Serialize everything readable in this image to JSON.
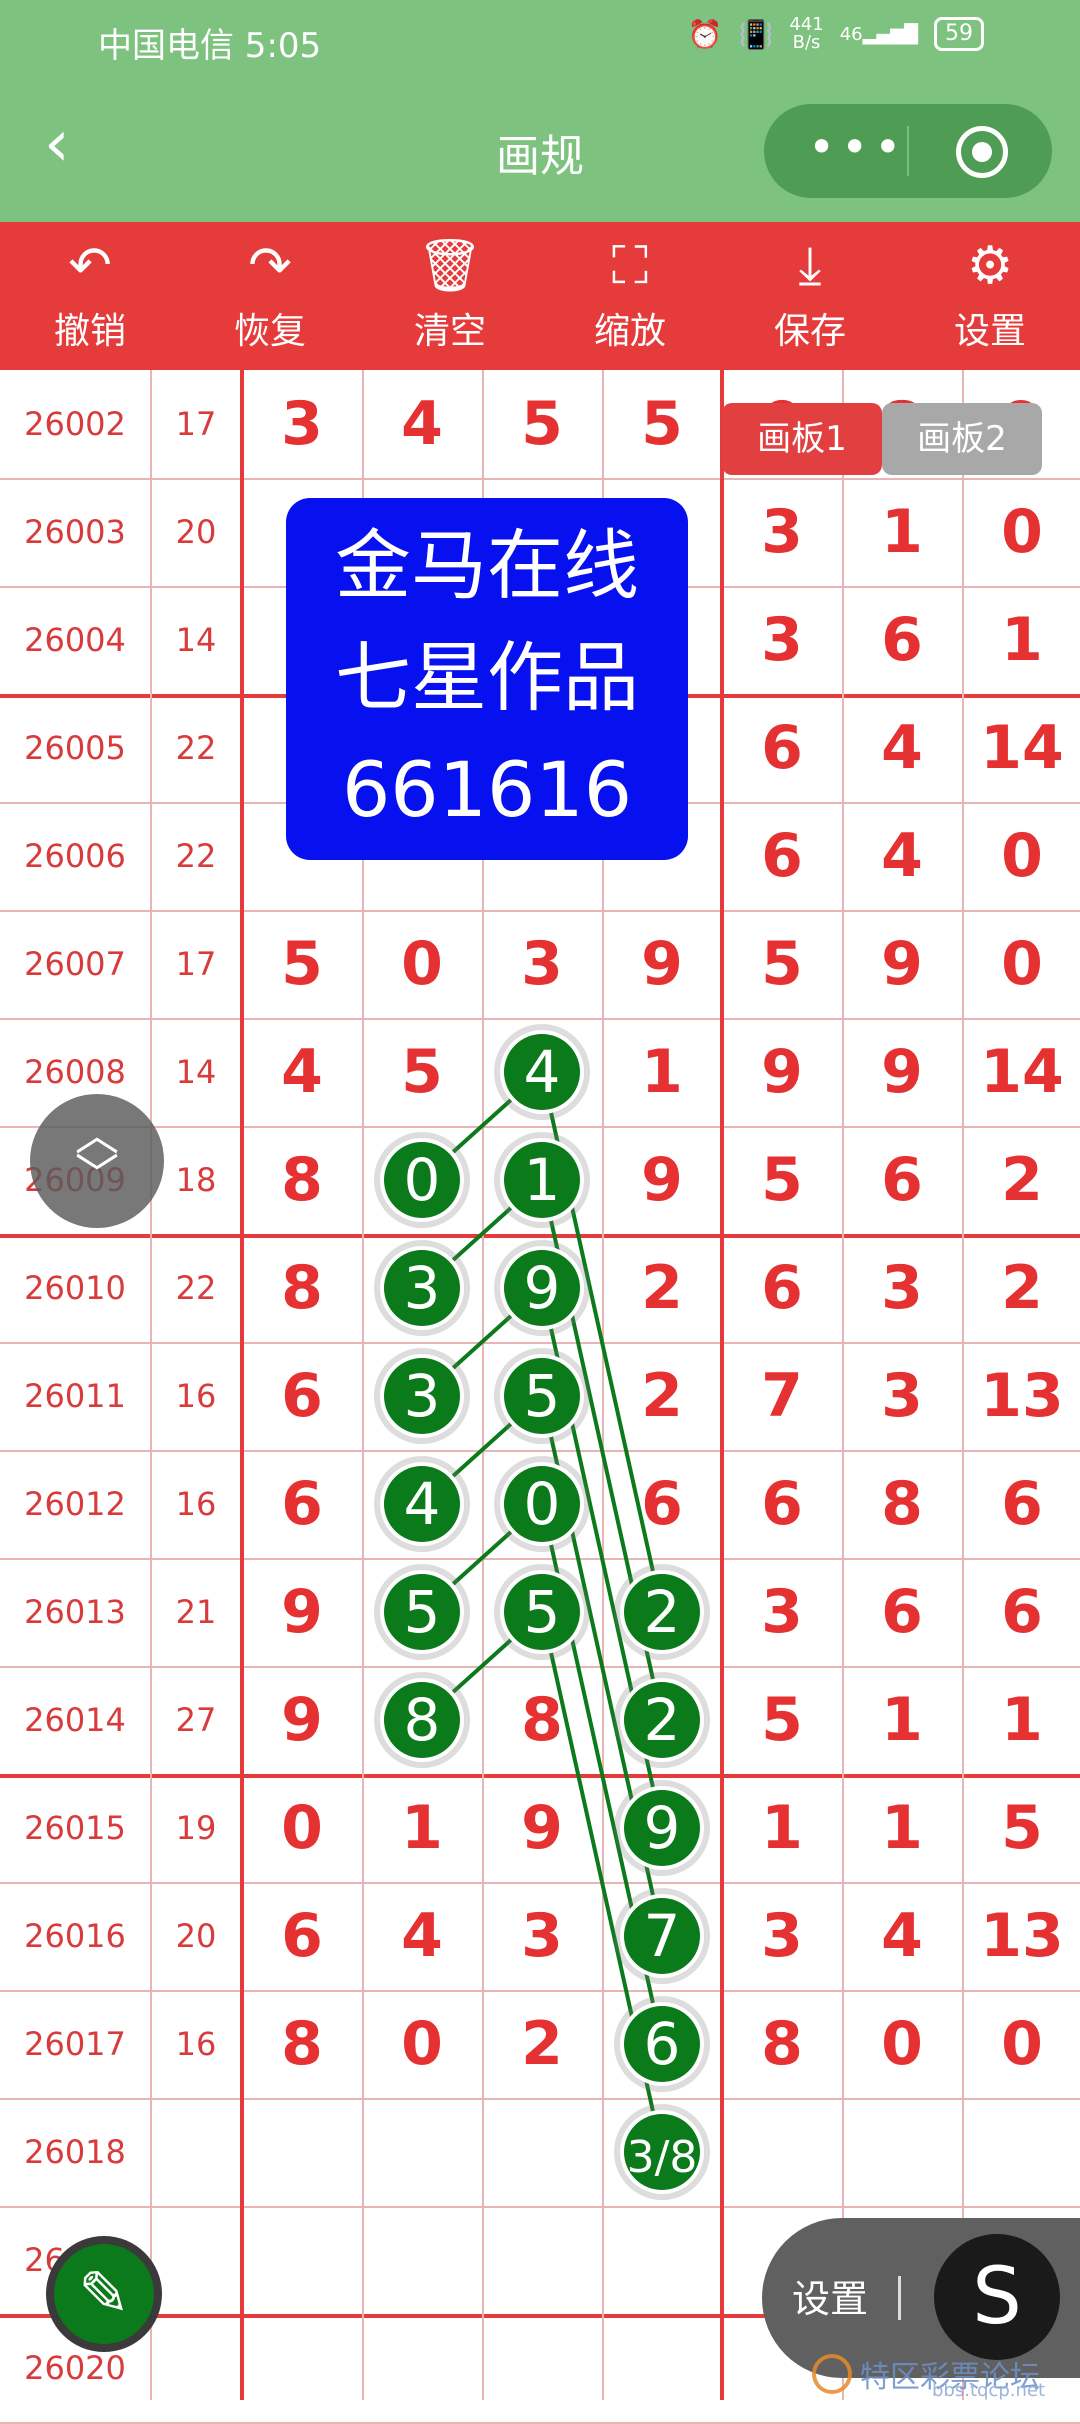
{
  "status_bar": {
    "carrier_time": "中国电信 5:05",
    "net_speed_value": "441",
    "net_speed_unit": "B/s",
    "signal": "46",
    "battery": "59",
    "icons": [
      "alarm-icon",
      "vibrate-icon",
      "signal-icon",
      "battery-icon"
    ]
  },
  "title_bar": {
    "back": "‹",
    "title": "画规"
  },
  "toolbar": [
    {
      "id": "undo",
      "label": "撤销",
      "icon": "↶",
      "icon_name": "undo-icon"
    },
    {
      "id": "redo",
      "label": "恢复",
      "icon": "↷",
      "icon_name": "redo-icon"
    },
    {
      "id": "clear",
      "label": "清空",
      "icon": "🗑",
      "icon_name": "trash-icon"
    },
    {
      "id": "zoom",
      "label": "缩放",
      "icon": "⛶",
      "icon_name": "zoom-icon"
    },
    {
      "id": "save",
      "label": "保存",
      "icon": "⤓",
      "icon_name": "download-icon"
    },
    {
      "id": "settings",
      "label": "设置",
      "icon": "⚙",
      "icon_name": "gear-icon"
    }
  ],
  "board_tabs": [
    {
      "label": "画板1",
      "active": true
    },
    {
      "label": "画板2",
      "active": false
    }
  ],
  "watermark": {
    "lines": [
      "金马在线",
      "七星作品",
      "661616"
    ]
  },
  "rows": [
    {
      "issue": "26002",
      "sum": "17",
      "nums": [
        "3",
        "4",
        "5",
        "5",
        "0",
        "8",
        "9"
      ]
    },
    {
      "issue": "26003",
      "sum": "20",
      "nums": [
        "",
        "",
        "",
        "",
        "3",
        "1",
        "0"
      ]
    },
    {
      "issue": "26004",
      "sum": "14",
      "nums": [
        "",
        "",
        "",
        "",
        "3",
        "6",
        "1"
      ]
    },
    {
      "issue": "26005",
      "sum": "22",
      "nums": [
        "",
        "",
        "",
        "",
        "6",
        "4",
        "14"
      ]
    },
    {
      "issue": "26006",
      "sum": "22",
      "nums": [
        "",
        "",
        "",
        "",
        "6",
        "4",
        "0"
      ]
    },
    {
      "issue": "26007",
      "sum": "17",
      "nums": [
        "5",
        "0",
        "3",
        "9",
        "5",
        "9",
        "0"
      ]
    },
    {
      "issue": "26008",
      "sum": "14",
      "nums": [
        "4",
        "5",
        "4",
        "1",
        "9",
        "9",
        "14"
      ]
    },
    {
      "issue": "26009",
      "sum": "18",
      "nums": [
        "8",
        "0",
        "1",
        "9",
        "5",
        "6",
        "2"
      ]
    },
    {
      "issue": "26010",
      "sum": "22",
      "nums": [
        "8",
        "3",
        "9",
        "2",
        "6",
        "3",
        "2"
      ]
    },
    {
      "issue": "26011",
      "sum": "16",
      "nums": [
        "6",
        "3",
        "5",
        "2",
        "7",
        "3",
        "13"
      ]
    },
    {
      "issue": "26012",
      "sum": "16",
      "nums": [
        "6",
        "4",
        "0",
        "6",
        "6",
        "8",
        "6"
      ]
    },
    {
      "issue": "26013",
      "sum": "21",
      "nums": [
        "9",
        "5",
        "5",
        "2",
        "3",
        "6",
        "6"
      ]
    },
    {
      "issue": "26014",
      "sum": "27",
      "nums": [
        "9",
        "8",
        "8",
        "2",
        "5",
        "1",
        "1"
      ]
    },
    {
      "issue": "26015",
      "sum": "19",
      "nums": [
        "0",
        "1",
        "9",
        "9",
        "1",
        "1",
        "5"
      ]
    },
    {
      "issue": "26016",
      "sum": "20",
      "nums": [
        "6",
        "4",
        "3",
        "7",
        "3",
        "4",
        "13"
      ]
    },
    {
      "issue": "26017",
      "sum": "16",
      "nums": [
        "8",
        "0",
        "2",
        "6",
        "8",
        "0",
        "0"
      ]
    },
    {
      "issue": "26018",
      "sum": "",
      "nums": [
        "",
        "",
        "",
        "",
        "",
        "",
        ""
      ]
    },
    {
      "issue": "26019",
      "sum": "",
      "nums": [
        "",
        "",
        "",
        "",
        "",
        "",
        ""
      ]
    },
    {
      "issue": "26020",
      "sum": "",
      "nums": [
        "",
        "",
        "",
        "",
        "",
        "",
        ""
      ]
    }
  ],
  "markers": [
    {
      "row": 6,
      "col": 2,
      "text": "4"
    },
    {
      "row": 7,
      "col": 1,
      "text": "0"
    },
    {
      "row": 7,
      "col": 2,
      "text": "1"
    },
    {
      "row": 8,
      "col": 1,
      "text": "3"
    },
    {
      "row": 8,
      "col": 2,
      "text": "9"
    },
    {
      "row": 9,
      "col": 1,
      "text": "3"
    },
    {
      "row": 9,
      "col": 2,
      "text": "5"
    },
    {
      "row": 10,
      "col": 1,
      "text": "4"
    },
    {
      "row": 10,
      "col": 2,
      "text": "0"
    },
    {
      "row": 11,
      "col": 1,
      "text": "5"
    },
    {
      "row": 11,
      "col": 2,
      "text": "5"
    },
    {
      "row": 11,
      "col": 3,
      "text": "2"
    },
    {
      "row": 12,
      "col": 1,
      "text": "8"
    },
    {
      "row": 12,
      "col": 3,
      "text": "2"
    },
    {
      "row": 13,
      "col": 3,
      "text": "9"
    },
    {
      "row": 14,
      "col": 3,
      "text": "7"
    },
    {
      "row": 15,
      "col": 3,
      "text": "6"
    },
    {
      "row": 16,
      "col": 3,
      "text": "3/8"
    }
  ],
  "lines": [
    [
      6,
      2,
      7,
      1
    ],
    [
      7,
      2,
      8,
      1
    ],
    [
      8,
      2,
      9,
      1
    ],
    [
      9,
      2,
      10,
      1
    ],
    [
      10,
      2,
      11,
      1
    ],
    [
      11,
      2,
      12,
      1
    ],
    [
      6,
      2,
      11,
      3
    ],
    [
      7,
      2,
      12,
      3
    ],
    [
      8,
      2,
      13,
      3
    ],
    [
      9,
      2,
      14,
      3
    ],
    [
      10,
      2,
      15,
      3
    ],
    [
      11,
      2,
      16,
      3
    ]
  ],
  "float_controls": {
    "settings_label": "设置",
    "s_button": "S",
    "pen_icon": "✎"
  },
  "forum_mark": {
    "text": "特区彩票论坛",
    "url": "bbs.tqcp.net"
  },
  "colors": {
    "header_green": "#7dc27f",
    "toolbar_red": "#e53b3b",
    "marker_green": "#0b7a1a",
    "number_red": "#e53131"
  }
}
